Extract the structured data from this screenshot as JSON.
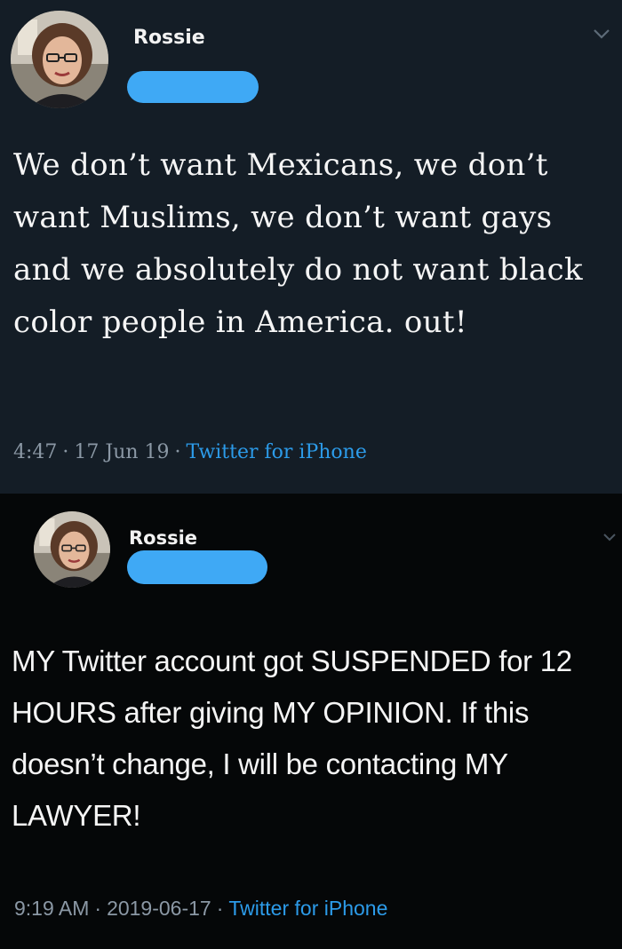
{
  "tweets": [
    {
      "author": {
        "name": "Rossie"
      },
      "text": "We don’t want Mexicans, we don’t want Muslims, we don’t want gays and we absolutely do not want black color people in America. out!",
      "meta": {
        "time": "4:47",
        "date": "17 Jun 19",
        "separator": "·",
        "source": "Twitter for iPhone"
      },
      "icons": {
        "avatar": "avatar-photo",
        "menu": "chevron-down-icon",
        "handle": "redacted-blur"
      }
    },
    {
      "author": {
        "name": "Rossie"
      },
      "text": "MY Twitter account got SUSPENDED for 12 HOURS after giving MY OPINION. If this doesn’t change, I will be contacting MY LAWYER!",
      "meta": {
        "time": "9:19 AM",
        "date": "2019-06-17",
        "separator": "·",
        "source": "Twitter for iPhone"
      },
      "icons": {
        "avatar": "avatar-photo",
        "menu": "chevron-down-icon",
        "handle": "redacted-blur"
      }
    }
  ],
  "colors": {
    "tweet1_bg": "#141d26",
    "tweet2_bg": "#050708",
    "link": "#2c9be9",
    "meta": "#8b98a5",
    "redaction": "#3fa9f5"
  }
}
